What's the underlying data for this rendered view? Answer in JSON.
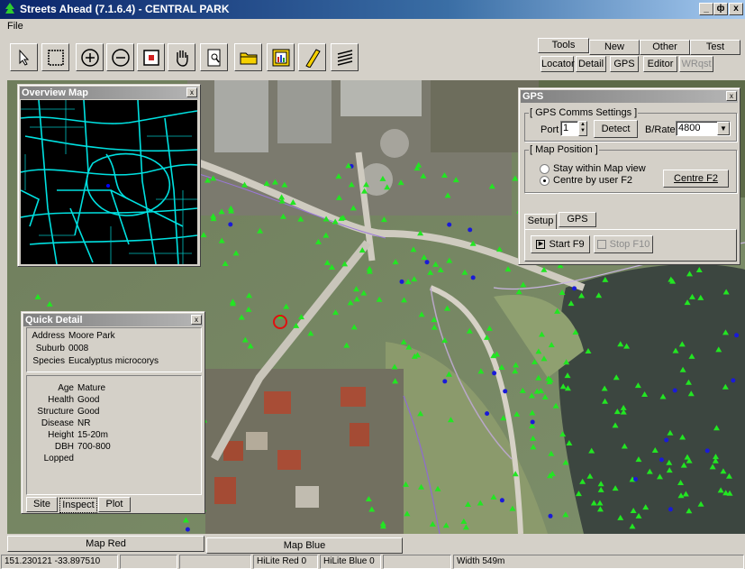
{
  "window": {
    "title": "Streets Ahead (7.1.6.4)  -  CENTRAL PARK",
    "min": "_",
    "restore": "ф",
    "close": "x"
  },
  "menu": {
    "file": "File"
  },
  "right_tabs": {
    "tools": "Tools",
    "new": "New",
    "other": "Other",
    "test": "Test"
  },
  "right_buttons": {
    "locator": "Locator",
    "detail": "Detail",
    "gps": "GPS",
    "editor": "Editor",
    "wrqst": "WRqst"
  },
  "overview": {
    "title": "Overview Map"
  },
  "gps_window": {
    "title": "GPS",
    "comms_group": "[ GPS Comms Settings ]",
    "port_label": "Port",
    "port_value": "1",
    "detect_label": "Detect",
    "brate_label": "B/Rate",
    "brate_value": "4800",
    "map_group": "[ Map Position ]",
    "opt_stay": "Stay within Map view",
    "opt_centre": "Centre by user F2",
    "centre_btn": "Centre F2",
    "tab_setup": "Setup",
    "tab_gps": "GPS",
    "start_btn": "Start F9",
    "stop_btn": "Stop F10"
  },
  "quick_detail": {
    "title": "Quick Detail",
    "top": [
      {
        "label": "Address",
        "value": "Moore Park"
      },
      {
        "label": "Suburb",
        "value": "0008"
      },
      {
        "label": "Species",
        "value": "Eucalyptus microcorys"
      }
    ],
    "attrs": [
      {
        "label": "Age",
        "value": "Mature"
      },
      {
        "label": "Health",
        "value": "Good"
      },
      {
        "label": "Structure",
        "value": "Good"
      },
      {
        "label": "Disease",
        "value": "NR"
      },
      {
        "label": "Height",
        "value": "15-20m"
      },
      {
        "label": "DBH",
        "value": "700-800"
      },
      {
        "label": "Lopped",
        "value": ""
      }
    ],
    "tabs": {
      "site": "Site",
      "inspect": "Inspect",
      "plot": "Plot"
    }
  },
  "bottom_tabs": {
    "red": "Map  Red",
    "blue": "Map  Blue"
  },
  "status": {
    "coords": "151.230121  -33.897510",
    "hilite_red": "HiLite Red 0",
    "hilite_blue": "HiLite Blue 0",
    "width": "Width 549m"
  },
  "colors": {
    "tree": "#22e622",
    "tree_blue": "#1a1ad8",
    "selected": "#e01010",
    "overview_lines": "#00e0e0"
  }
}
